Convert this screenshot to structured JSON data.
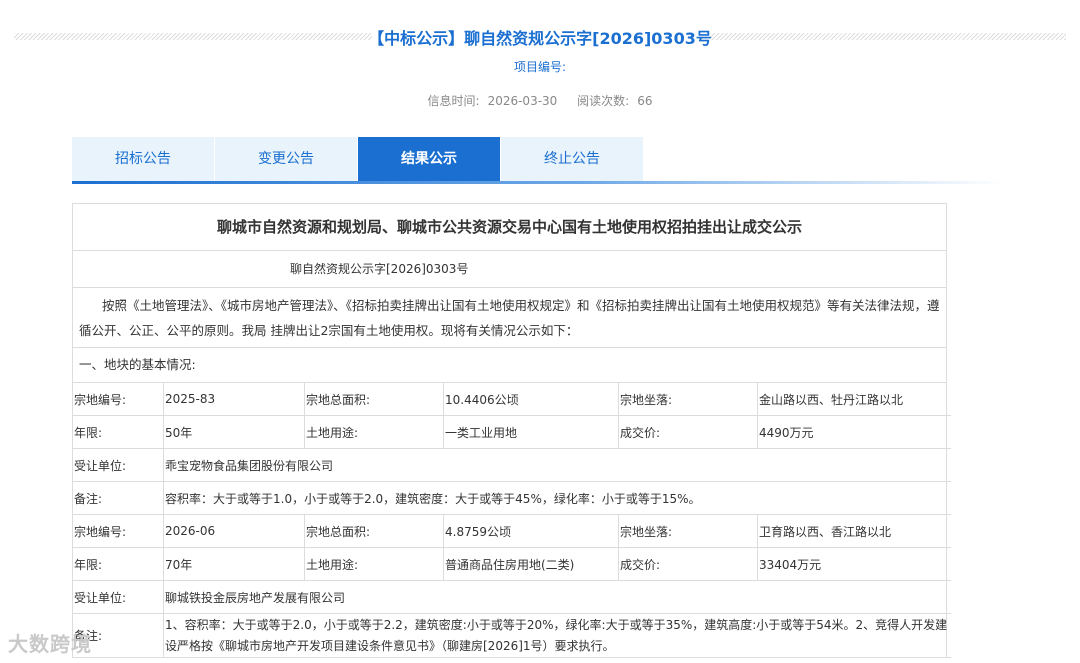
{
  "header": {
    "title": "【中标公示】聊自然资规公示字[2026]0303号",
    "project_label": "项目编号:",
    "project_value": "",
    "info_time_label": "信息时间:",
    "info_time": "2026-03-30",
    "read_count_label": "阅读次数:",
    "read_count": "66"
  },
  "tabs": [
    {
      "label": "招标公告",
      "active": false
    },
    {
      "label": "变更公告",
      "active": false
    },
    {
      "label": "结果公示",
      "active": true
    },
    {
      "label": "终止公告",
      "active": false
    }
  ],
  "doc": {
    "title": "聊城市自然资源和规划局、聊城市公共资源交易中心国有土地使用权招拍挂出让成交公示",
    "number": "聊自然资规公示字[2026]0303号",
    "intro": "按照《土地管理法》、《城市房地产管理法》、《招标拍卖挂牌出让国有土地使用权规定》和《招标拍卖挂牌出让国有土地使用权规范》等有关法律法规，遵循公开、公正、公平的原则。我局 挂牌出让2宗国有土地使用权。现将有关情况公示如下：",
    "section1": "一、地块的基本情况:",
    "labels": {
      "parcel_no": "宗地编号:",
      "total_area": "宗地总面积:",
      "location": "宗地坐落:",
      "term": "年限:",
      "land_use": "土地用途:",
      "price": "成交价:",
      "assignee": "受让单位:",
      "remark": "备注:"
    },
    "parcels": [
      {
        "parcel_no": "2025-83",
        "total_area": "10.4406公顷",
        "location": "金山路以西、牡丹江路以北",
        "term": "50年",
        "land_use": "一类工业用地",
        "price": "4490万元",
        "assignee": "乖宝宠物食品集团股份有限公司",
        "remark": "容积率：大于或等于1.0，小于或等于2.0，建筑密度：大于或等于45%，绿化率：小于或等于15%。"
      },
      {
        "parcel_no": "2026-06",
        "total_area": "4.8759公顷",
        "location": "卫育路以西、香江路以北",
        "term": "70年",
        "land_use": "普通商品住房用地(二类)",
        "price": "33404万元",
        "assignee": "聊城铁投金辰房地产发展有限公司",
        "remark": "1、容积率：大于或等于2.0，小于或等于2.2，建筑密度:小于或等于20%，绿化率:大于或等于35%，建筑高度:小于或等于54米。2、竞得人开发建设严格按《聊城市房地产开发项目建设条件意见书》（聊建房[2026]1号）要求执行。"
      }
    ]
  },
  "watermark": "大数跨境"
}
